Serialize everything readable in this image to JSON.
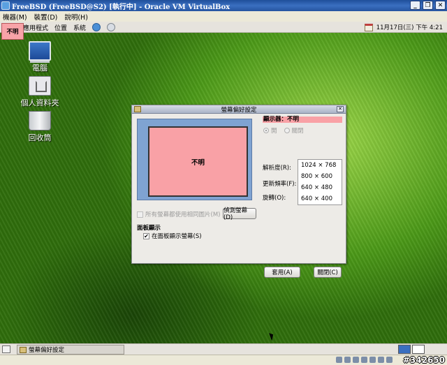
{
  "vbox": {
    "title": "FreeBSD (FreeBSD@S2) [執行中] - Oracle VM VirtualBox",
    "menu": [
      "機器(M)",
      "裝置(D)",
      "說明(H)"
    ]
  },
  "gnome_panel": {
    "menus": [
      "應用程式",
      "位置",
      "系統"
    ],
    "clock": "11月17日(三) 下午 4:21"
  },
  "desktop": {
    "unknown_badge": "不明",
    "icons": [
      "電腦",
      "個人資料夾",
      "回收筒"
    ]
  },
  "dialog": {
    "title": "螢幕偏好設定",
    "preview_label": "不明",
    "mirror_label": "所有螢幕都使用相同圖片(M)",
    "detect_button": "偵測螢幕(D)",
    "panel_heading": "面板顯示",
    "panel_checkbox_label": "在面板顯示螢幕(S)",
    "panel_checked": true,
    "monitor_label": "顯示器：不明",
    "radio_on": "開",
    "radio_off": "關閉",
    "resolution_label": "解析度(R):",
    "refresh_label": "更新頻率(F):",
    "rotation_label": "旋轉(O):",
    "resolutions": [
      "1024 × 768",
      "800 × 600",
      "640 × 480",
      "640 × 400"
    ],
    "apply_button": "套用(A)",
    "close_button": "關閉(C)"
  },
  "taskbar": {
    "task_label": "螢幕偏好設定"
  },
  "watermark": "#342650",
  "colors": {
    "accent_pink": "#f9a1a6",
    "preview_blue": "#7fa3d2",
    "title_blue": "#2554a0"
  }
}
